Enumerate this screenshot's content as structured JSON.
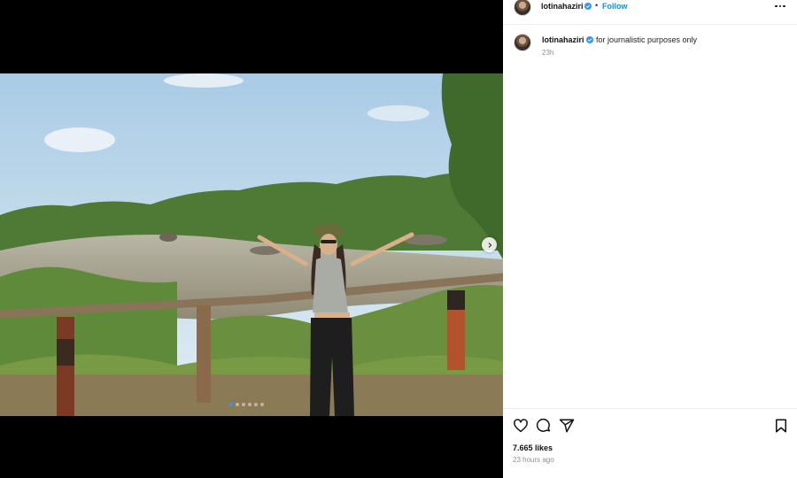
{
  "post": {
    "username": "lotinahaziri",
    "separator": "•",
    "follow_label": "Follow",
    "caption": "for journalistic purposes only",
    "caption_time": "23h",
    "likes": "7.665 likes",
    "time_ago": "23 hours ago",
    "carousel": {
      "total": 6,
      "active_index": 0
    }
  },
  "icons": {
    "verified": "verified-badge-icon",
    "more": "more-options-icon",
    "like": "heart-icon",
    "comment": "comment-icon",
    "share": "paper-plane-icon",
    "save": "bookmark-icon",
    "next": "chevron-right-icon"
  },
  "colors": {
    "link_blue": "#0095f6",
    "verified_blue": "#3897f0",
    "muted_text": "#8e8e8e"
  }
}
